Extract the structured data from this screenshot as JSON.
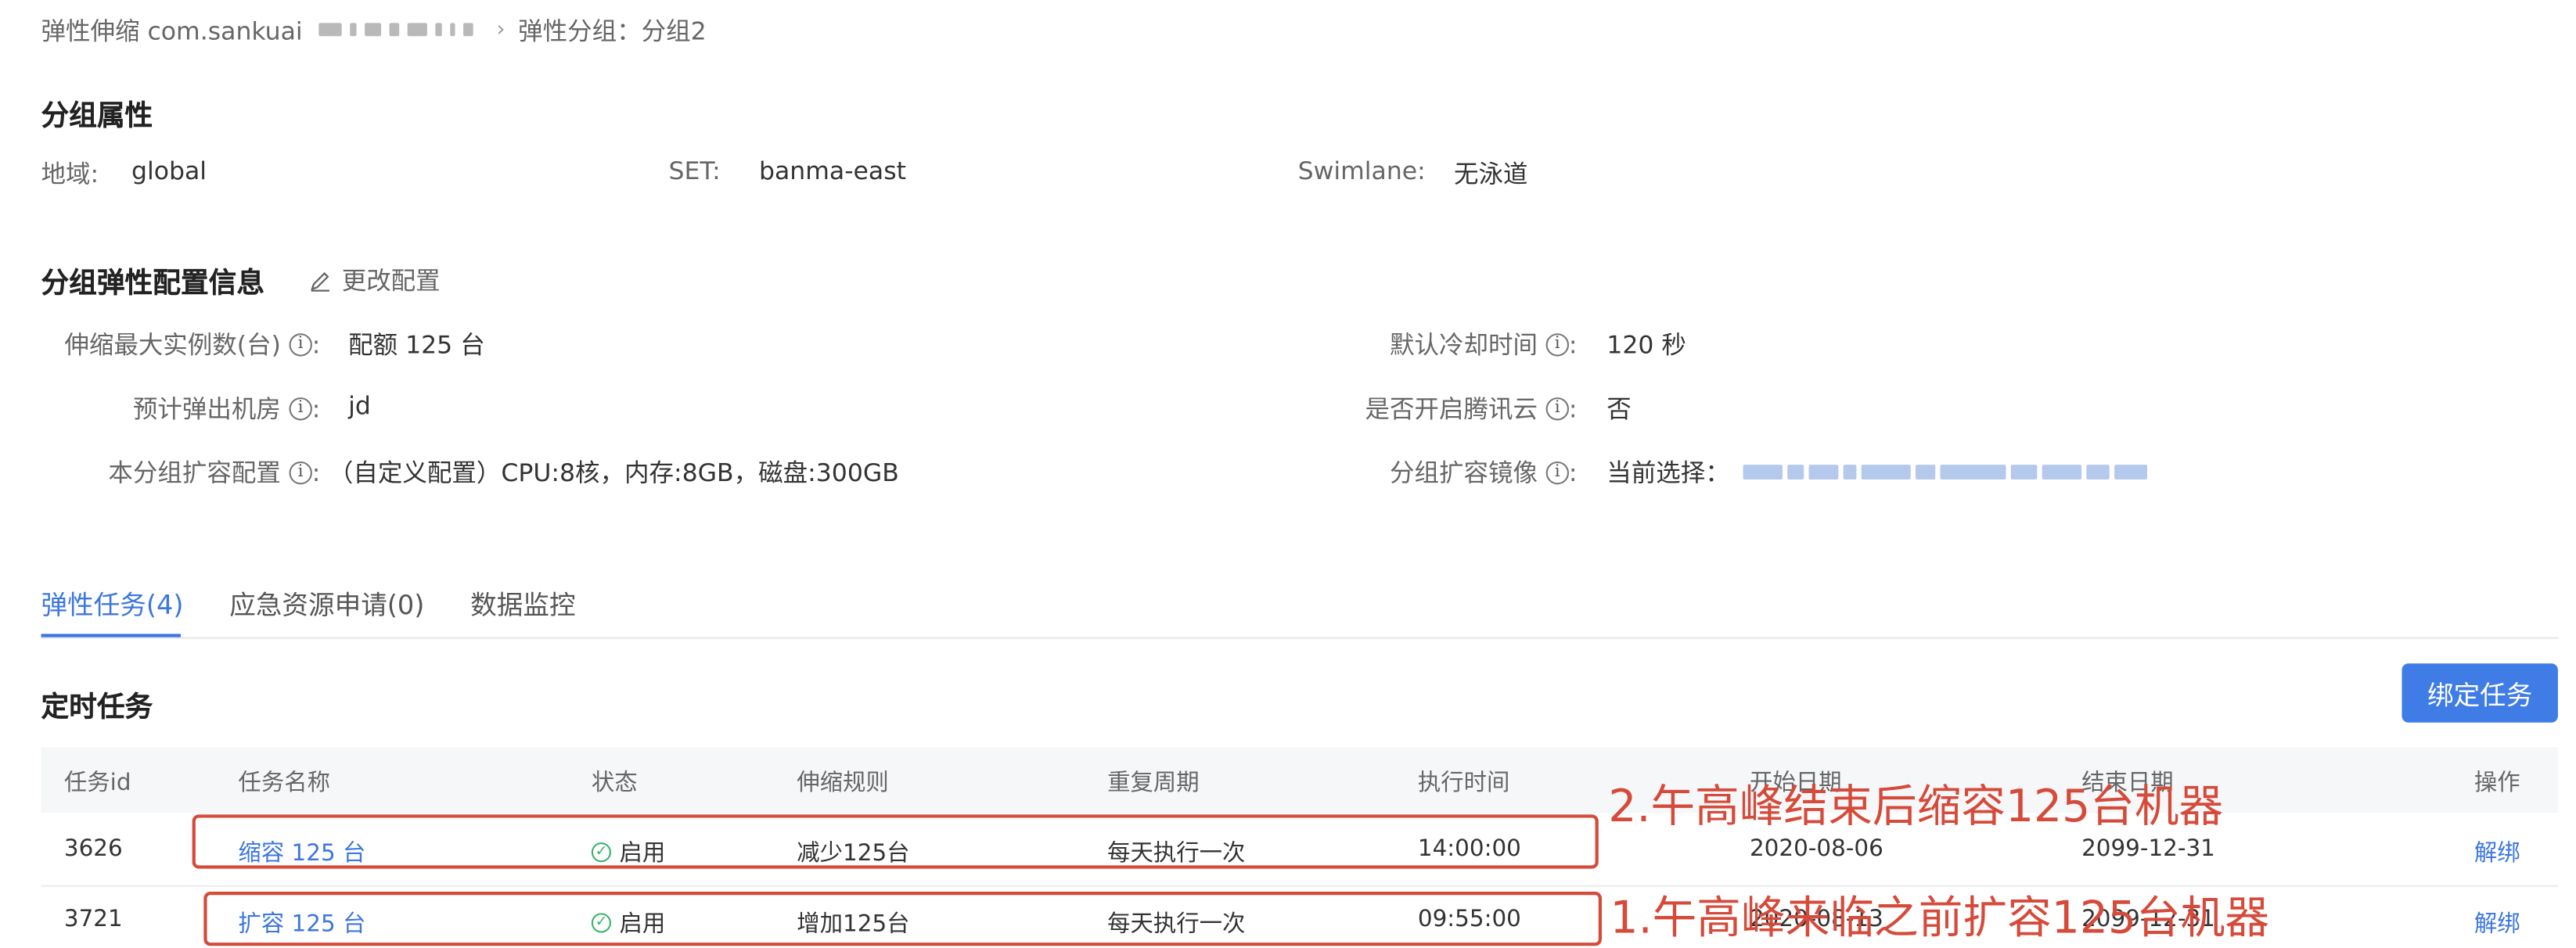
{
  "breadcrumb": {
    "root": "弹性伸缩 com.sankuai",
    "current": "弹性分组：分组2"
  },
  "group_attrs": {
    "title": "分组属性",
    "region_label": "地域:",
    "region_value": "global",
    "set_label": "SET:",
    "set_value": "banma-east",
    "swimlane_label": "Swimlane:",
    "swimlane_value": "无泳道"
  },
  "elastic_config": {
    "title": "分组弹性配置信息",
    "edit_label": "更改配置",
    "max_instances_label": "伸缩最大实例数(台)",
    "max_instances_value": "配额 125 台",
    "datacenter_label": "预计弹出机房",
    "datacenter_value": "jd",
    "expand_config_label": "本分组扩容配置",
    "expand_config_value": "（自定义配置）CPU:8核，内存:8GB，磁盘:300GB",
    "cooldown_label": "默认冷却时间",
    "cooldown_value": "120 秒",
    "tencent_label": "是否开启腾讯云",
    "tencent_value": "否",
    "image_label": "分组扩容镜像",
    "image_value": "当前选择："
  },
  "tabs": [
    {
      "label": "弹性任务(4)",
      "active": true
    },
    {
      "label": "应急资源申请(0)",
      "active": false
    },
    {
      "label": "数据监控",
      "active": false
    }
  ],
  "scheduled": {
    "title": "定时任务",
    "bind_button": "绑定任务"
  },
  "table": {
    "columns": [
      "任务id",
      "任务名称",
      "状态",
      "伸缩规则",
      "重复周期",
      "执行时间",
      "开始日期",
      "结束日期",
      "操作"
    ],
    "rows": [
      {
        "id": "3626",
        "name": "缩容 125 台",
        "status": "启用",
        "rule": "减少125台",
        "repeat": "每天执行一次",
        "time": "14:00:00",
        "start": "2020-08-06",
        "end": "2099-12-31",
        "action": "解绑"
      },
      {
        "id": "3721",
        "name": "扩容 125 台",
        "status": "启用",
        "rule": "增加125台",
        "repeat": "每天执行一次",
        "time": "09:55:00",
        "start": "2020-08-13",
        "end": "2099-12-31",
        "action": "解绑"
      }
    ]
  },
  "annotations": {
    "note1": "2.午高峰结束后缩容125台机器",
    "note2": "1.午高峰来临之前扩容125台机器"
  },
  "colors": {
    "accent": "#3c76e0",
    "annotation": "#d64a3a",
    "success": "#3bb36b"
  }
}
